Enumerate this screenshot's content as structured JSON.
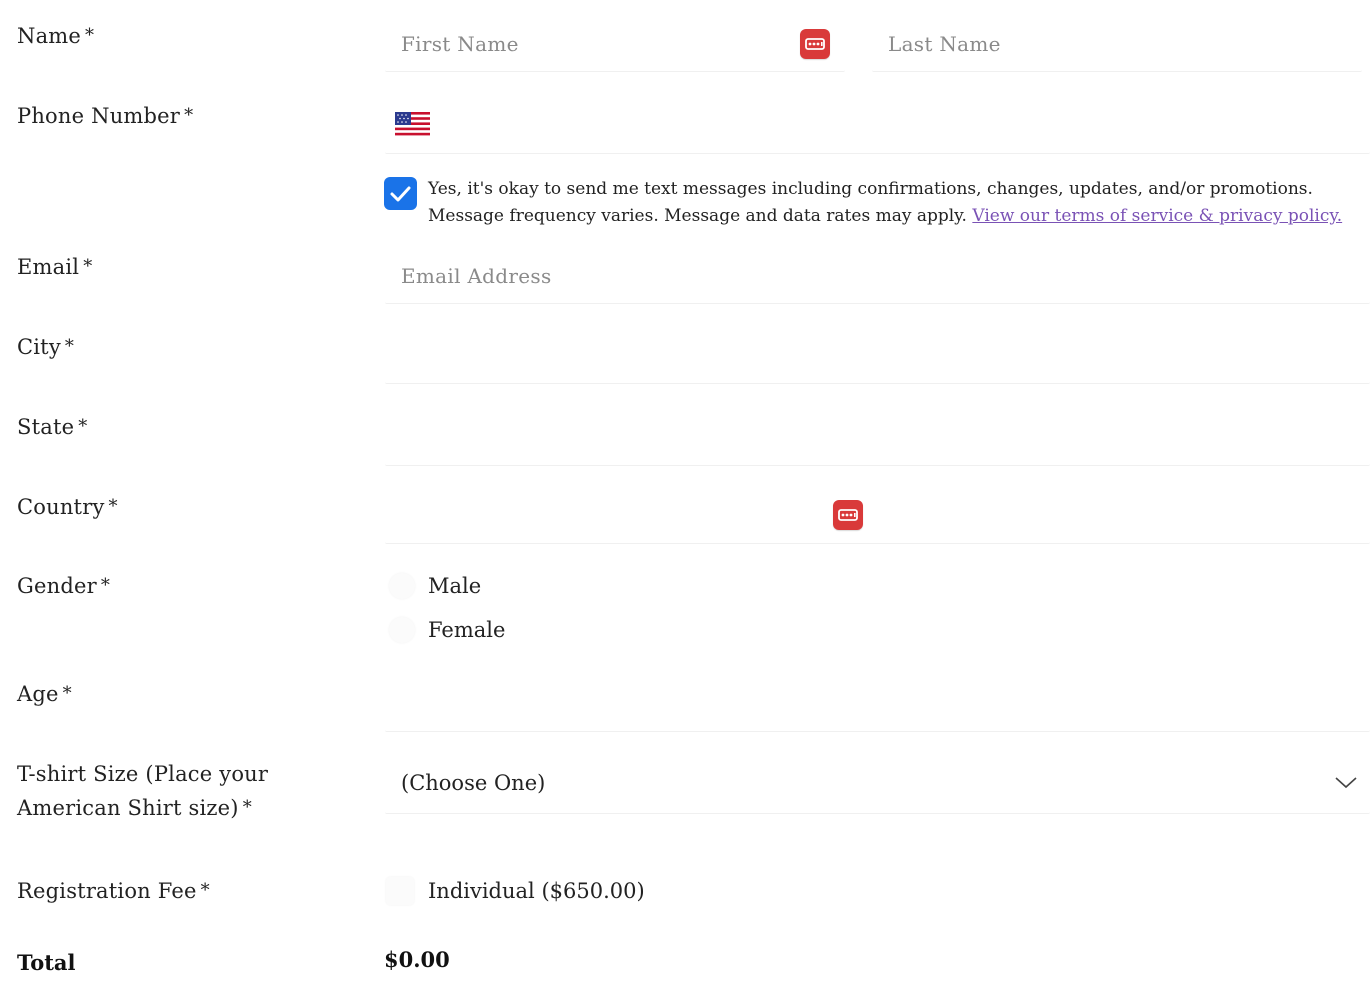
{
  "form": {
    "name": {
      "label": "Name",
      "required_mark": "*",
      "first_placeholder": "First Name",
      "last_placeholder": "Last Name",
      "autofill_icon": "password-manager-icon"
    },
    "phone": {
      "label": "Phone Number",
      "required_mark": "*",
      "country_flag_icon": "us-flag-icon",
      "value": ""
    },
    "sms_consent": {
      "checked": true,
      "text": "Yes, it's okay to send me text messages including confirmations, changes, updates, and/or promotions. Message frequency varies. Message and data rates may apply.",
      "link_text": "View our terms of service & privacy policy."
    },
    "email": {
      "label": "Email",
      "required_mark": "*",
      "placeholder": "Email Address"
    },
    "city": {
      "label": "City",
      "required_mark": "*",
      "value": ""
    },
    "state": {
      "label": "State",
      "required_mark": "*",
      "value": ""
    },
    "country": {
      "label": "Country",
      "required_mark": "*",
      "value": "",
      "autofill_icon": "password-manager-icon"
    },
    "gender": {
      "label": "Gender",
      "required_mark": "*",
      "options": [
        "Male",
        "Female"
      ]
    },
    "age": {
      "label": "Age",
      "required_mark": "*",
      "value": ""
    },
    "tshirt": {
      "label_line1": "T-shirt Size (Place your",
      "label_line2": "American Shirt size)",
      "required_mark": "*",
      "selected": "(Choose One)"
    },
    "registration_fee": {
      "label": "Registration Fee",
      "required_mark": "*",
      "option": "Individual ($650.00)"
    },
    "total": {
      "label": "Total",
      "value": "$0.00"
    }
  },
  "colors": {
    "checkbox_accent": "#1a73e8",
    "link": "#7a52b5",
    "autofill_icon": "#d93a3a"
  }
}
